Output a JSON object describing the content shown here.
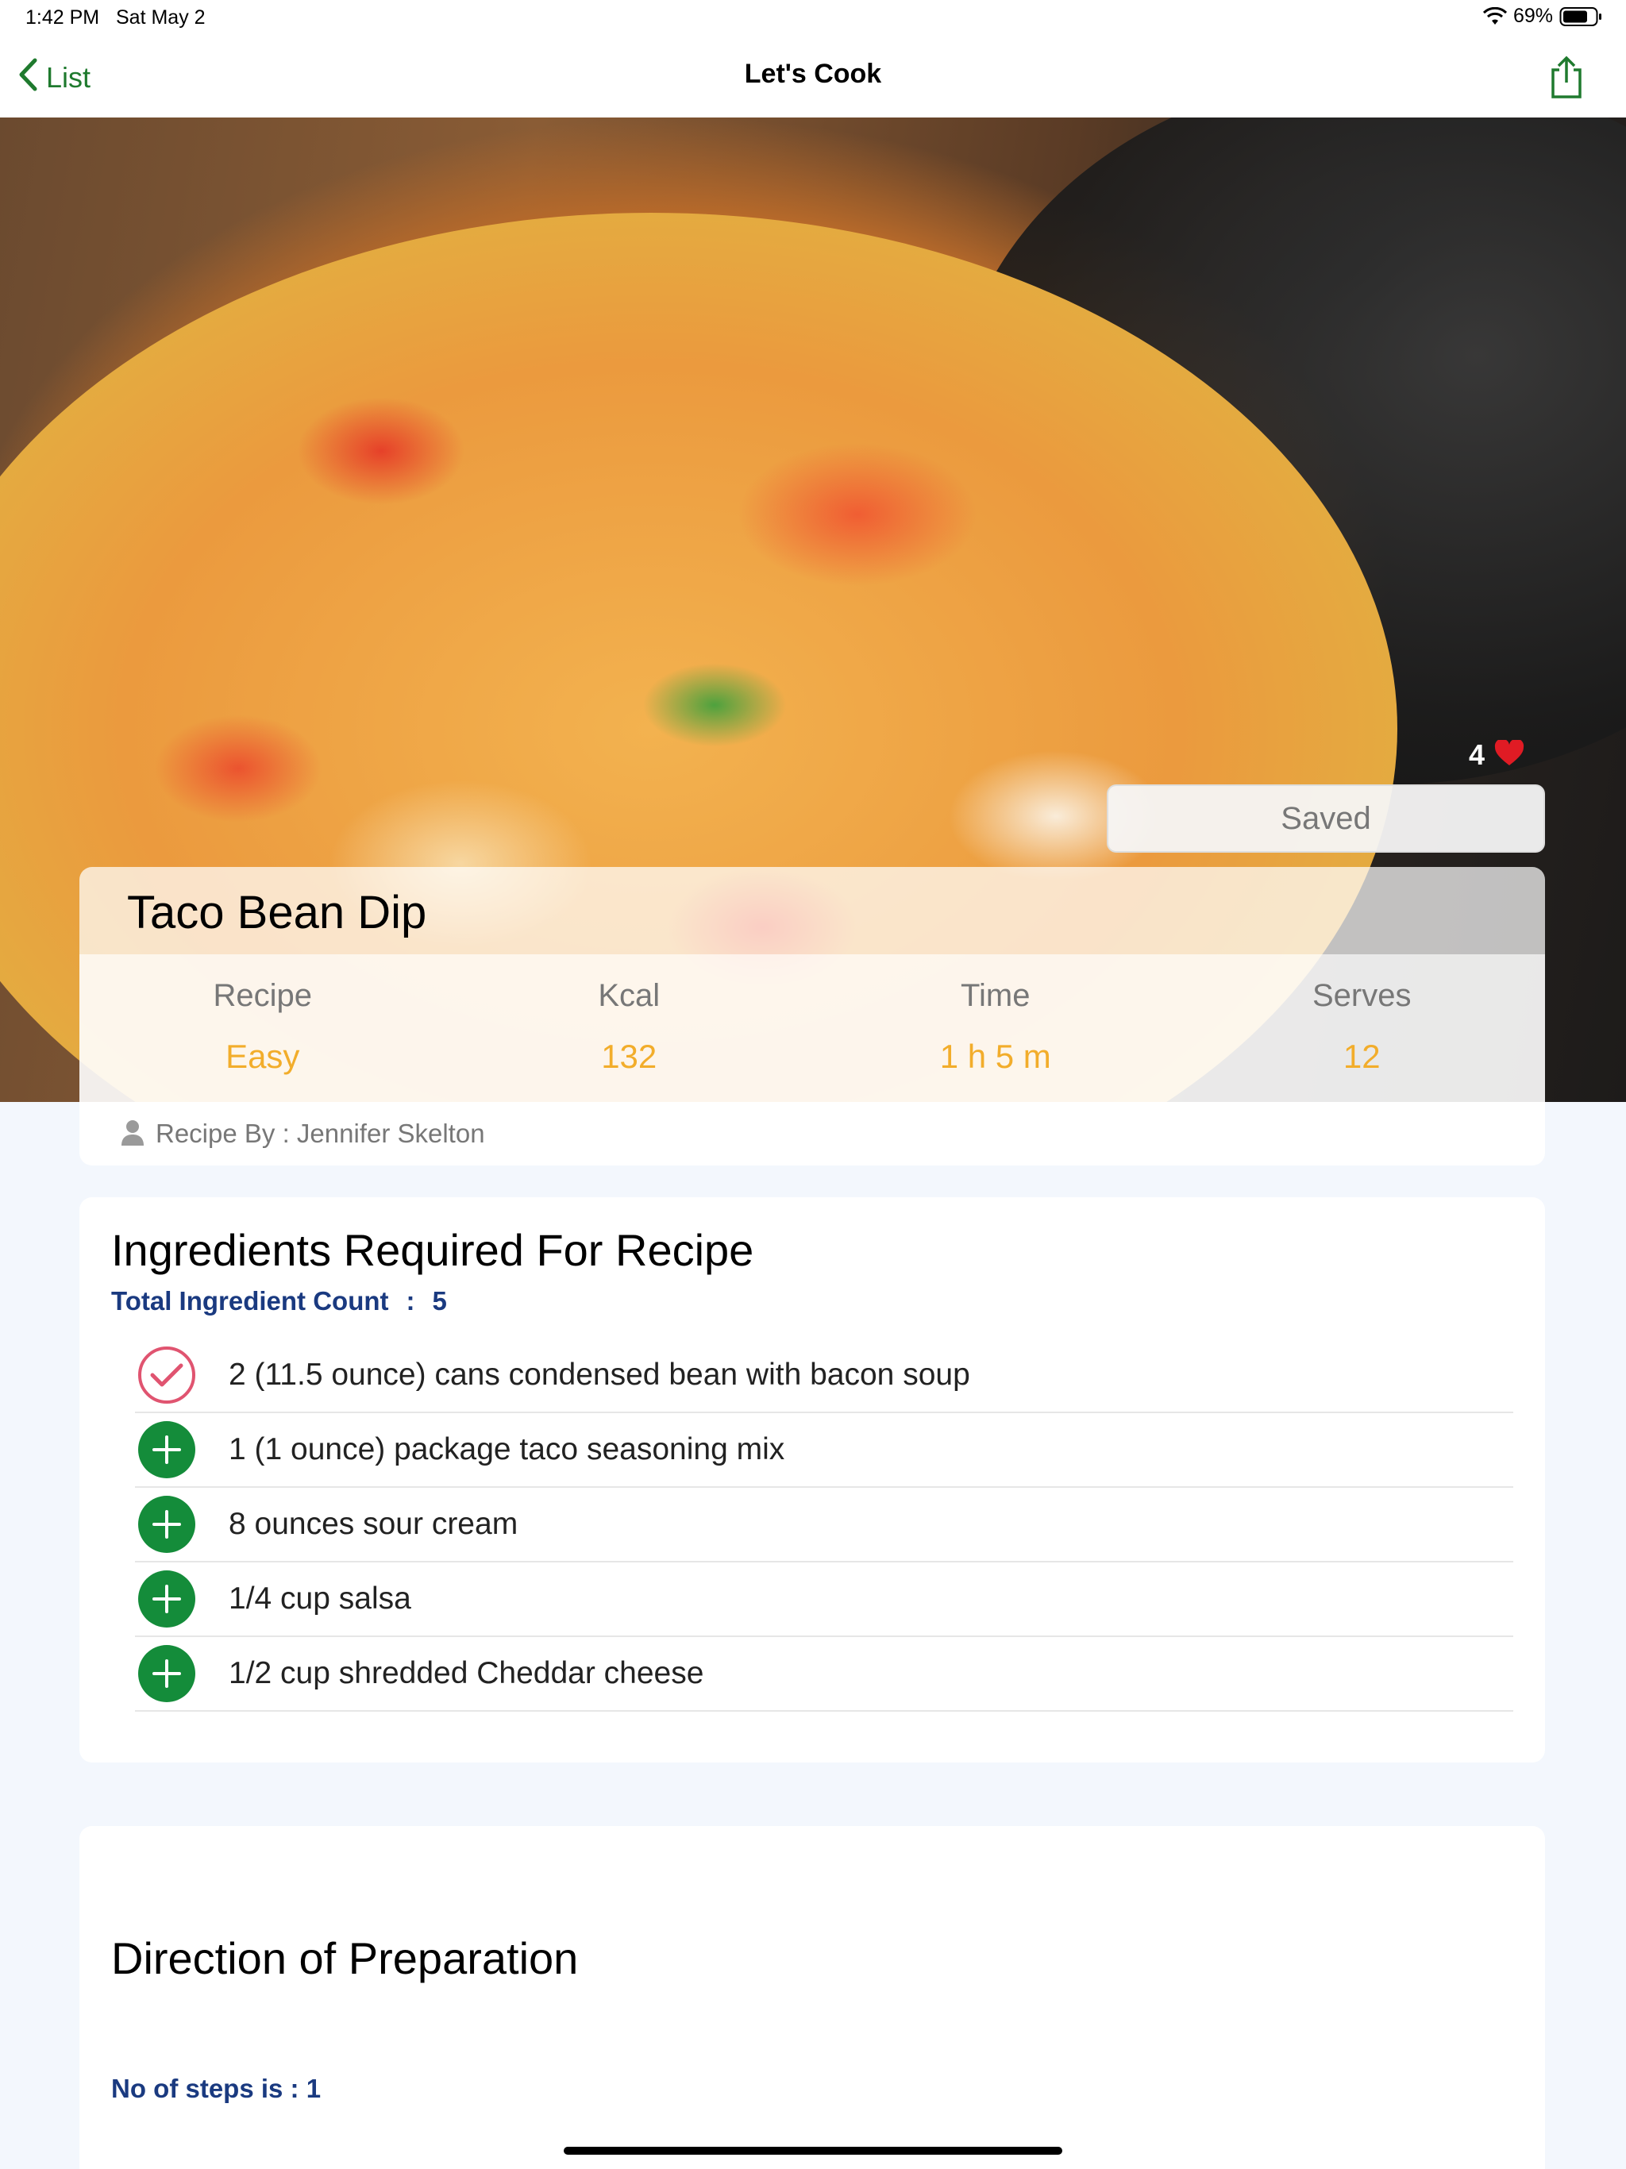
{
  "status_bar": {
    "time": "1:42 PM",
    "date": "Sat May 2",
    "battery": "69%"
  },
  "nav": {
    "back_label": "List",
    "title": "Let's Cook"
  },
  "hero": {
    "favorite_count": "4",
    "saved_label": "Saved"
  },
  "recipe": {
    "title": "Taco Bean Dip",
    "stats": [
      {
        "label": "Recipe",
        "value": "Easy"
      },
      {
        "label": "Kcal",
        "value": "132"
      },
      {
        "label": "Time",
        "value": "1 h 5 m"
      },
      {
        "label": "Serves",
        "value": "12"
      }
    ],
    "author": "Recipe By : Jennifer Skelton"
  },
  "ingredients": {
    "heading": "Ingredients Required For Recipe",
    "count_label": "Total Ingredient Count",
    "count_sep": ":",
    "count_value": "5",
    "items": [
      {
        "text": "2 (11.5 ounce) cans condensed bean with bacon soup",
        "state": "checked"
      },
      {
        "text": "1 (1 ounce) package taco seasoning mix",
        "state": "add"
      },
      {
        "text": "8 ounces sour cream",
        "state": "add"
      },
      {
        "text": "1/4 cup salsa",
        "state": "add"
      },
      {
        "text": "1/2 cup shredded Cheddar cheese",
        "state": "add"
      }
    ]
  },
  "directions": {
    "heading": "Direction of Preparation",
    "steps_label": "No of steps is : 1"
  },
  "colors": {
    "accent_green": "#148c3a",
    "stat_value": "#f2ad2b",
    "heart": "#e01b24",
    "checked_ring": "#e05470",
    "count_text": "#1a3a80"
  }
}
